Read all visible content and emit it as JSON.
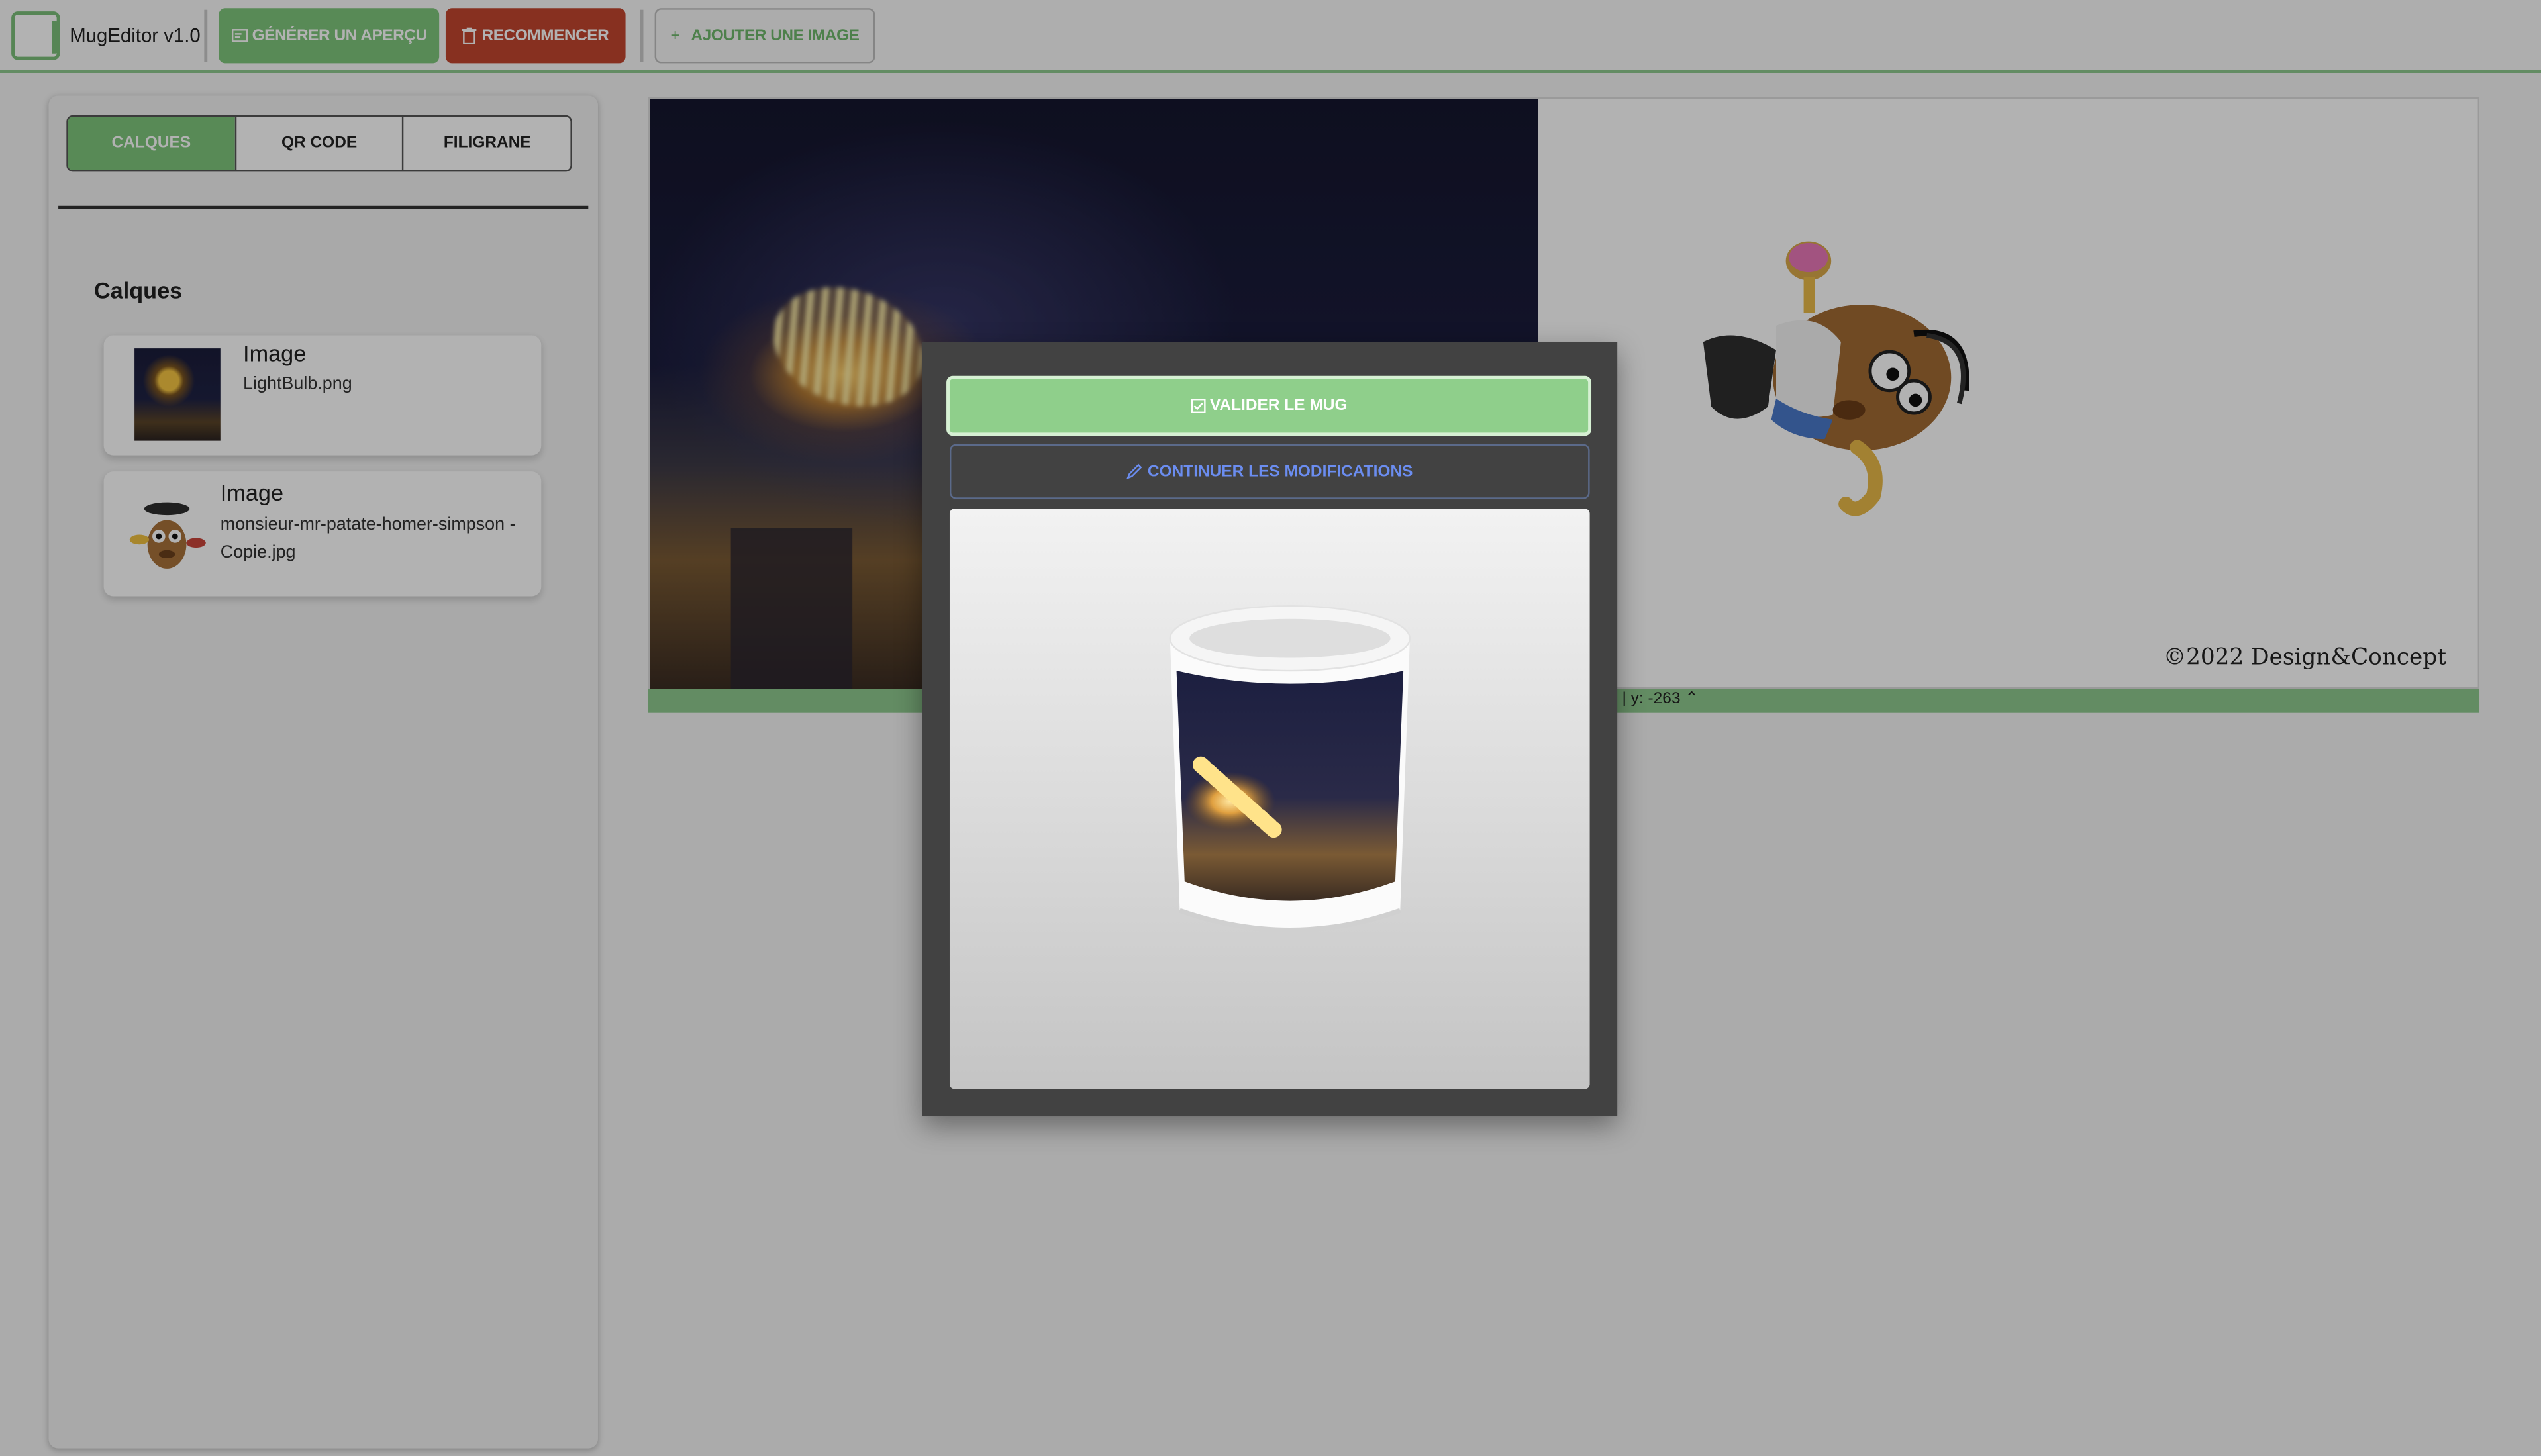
{
  "app": {
    "title": "MugEditor v1.0"
  },
  "toolbar": {
    "generate_label": "GÉNÉRER UN APERÇU",
    "restart_label": "RECOMMENCER",
    "add_image_label": "AJOUTER UNE IMAGE",
    "add_image_prefix": "+"
  },
  "sidebar": {
    "tabs": [
      {
        "label": "CALQUES",
        "active": true
      },
      {
        "label": "QR CODE",
        "active": false
      },
      {
        "label": "FILIGRANE",
        "active": false
      }
    ],
    "section_title": "Calques",
    "layers": [
      {
        "kind": "Image",
        "filename": "LightBulb.png",
        "thumb_icon": "lightbulb-thumbnail"
      },
      {
        "kind": "Image",
        "filename_line1": "monsieur-mr-patate-homer-simpson -",
        "filename_line2": "Copie.jpg",
        "thumb_icon": "potato-thumbnail"
      }
    ]
  },
  "canvas": {
    "copyright": "©2022 Design&Concept",
    "coord_readout": "| y: -263"
  },
  "modal": {
    "validate_label": "VALIDER LE MUG",
    "continue_label": "CONTINUER LES MODIFICATIONS"
  },
  "colors": {
    "accent_green": "#7fc67c",
    "danger_red": "#c2462e",
    "link_blue": "#6b8df0",
    "modal_bg": "#424242"
  }
}
